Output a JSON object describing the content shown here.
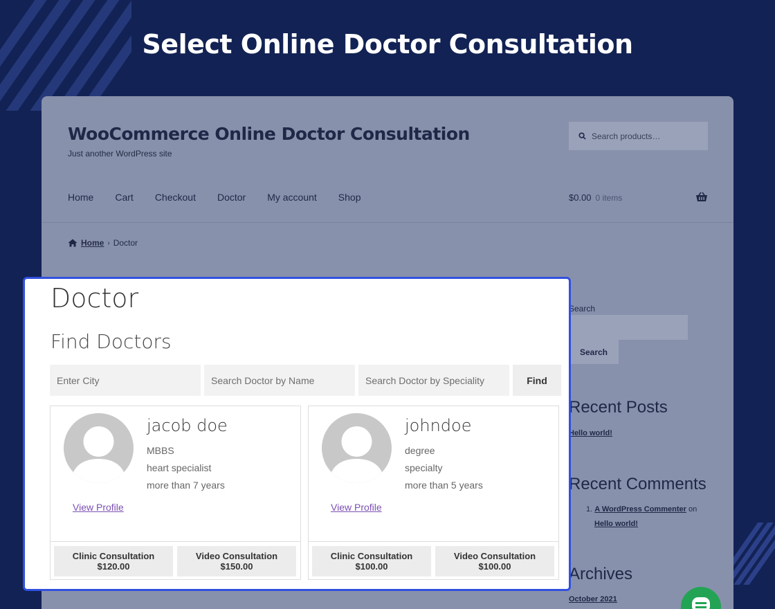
{
  "headline": "Select Online Doctor Consultation",
  "site": {
    "title": "WooCommerce Online Doctor Consultation",
    "tagline": "Just another WordPress site",
    "search_placeholder": "Search products…",
    "nav": [
      "Home",
      "Cart",
      "Checkout",
      "Doctor",
      "My account",
      "Shop"
    ],
    "cart_amount": "$0.00",
    "cart_items": "0 items",
    "breadcrumb_home": "Home",
    "breadcrumb_current": "Doctor"
  },
  "sidebar": {
    "search_label": "Search",
    "search_button": "Search",
    "recent_posts_title": "Recent Posts",
    "recent_post": "Hello world!",
    "recent_comments_title": "Recent Comments",
    "comment_num": "1.",
    "comment_author": "A WordPress Commenter",
    "comment_on": "on",
    "comment_post": "Hello world!",
    "archives_title": "Archives",
    "archive_item": "October 2021"
  },
  "panel": {
    "page_title": "Doctor",
    "find_title": "Find Doctors",
    "city_placeholder": "Enter City",
    "name_placeholder": "Search Doctor by Name",
    "speciality_placeholder": "Search Doctor by Speciality",
    "find_button": "Find",
    "view_profile": "View Profile"
  },
  "doctors": [
    {
      "name": "jacob doe",
      "degree": "MBBS",
      "specialty": "heart specialist",
      "experience": "more than 7 years",
      "clinic_label": "Clinic Consultation",
      "clinic_price": "$120.00",
      "video_label": "Video Consultation",
      "video_price": "$150.00"
    },
    {
      "name": "johndoe",
      "degree": "degree",
      "specialty": "specialty",
      "experience": "more than 5 years",
      "clinic_label": "Clinic Consultation",
      "clinic_price": "$100.00",
      "video_label": "Video Consultation",
      "video_price": "$100.00"
    }
  ],
  "colors": {
    "background": "#122254",
    "panel_border": "#3150e0",
    "link": "#7b4fb4"
  }
}
